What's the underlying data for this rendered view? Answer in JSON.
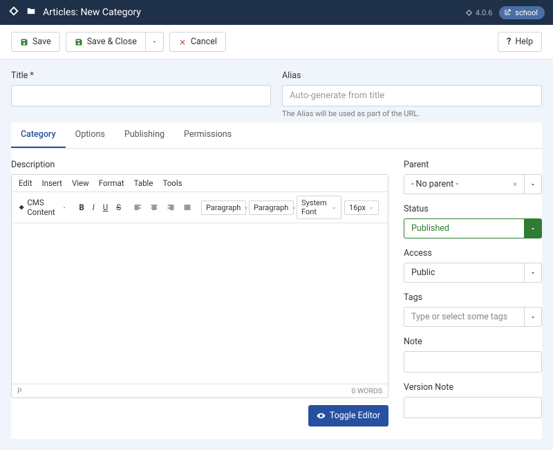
{
  "header": {
    "title": "Articles: New Category",
    "version": "4.0.6",
    "site_name": "school"
  },
  "toolbar": {
    "save": "Save",
    "save_close": "Save & Close",
    "cancel": "Cancel",
    "help": "Help"
  },
  "form": {
    "title_label": "Title *",
    "alias_label": "Alias",
    "alias_placeholder": "Auto-generate from title",
    "alias_hint": "The Alias will be used as part of the URL."
  },
  "tabs": {
    "category": "Category",
    "options": "Options",
    "publishing": "Publishing",
    "permissions": "Permissions"
  },
  "editor": {
    "label": "Description",
    "menu": {
      "edit": "Edit",
      "insert": "Insert",
      "view": "View",
      "format": "Format",
      "table": "Table",
      "tools": "Tools"
    },
    "cms": "CMS Content",
    "block1": "Paragraph",
    "block2": "Paragraph",
    "font": "System Font",
    "size": "16px",
    "path": "P",
    "words": "0 words",
    "toggle": "Toggle Editor"
  },
  "sidebar": {
    "parent": {
      "label": "Parent",
      "value": "- No parent -"
    },
    "status": {
      "label": "Status",
      "value": "Published"
    },
    "access": {
      "label": "Access",
      "value": "Public"
    },
    "tags": {
      "label": "Tags",
      "placeholder": "Type or select some tags"
    },
    "note": {
      "label": "Note"
    },
    "version_note": {
      "label": "Version Note"
    }
  }
}
